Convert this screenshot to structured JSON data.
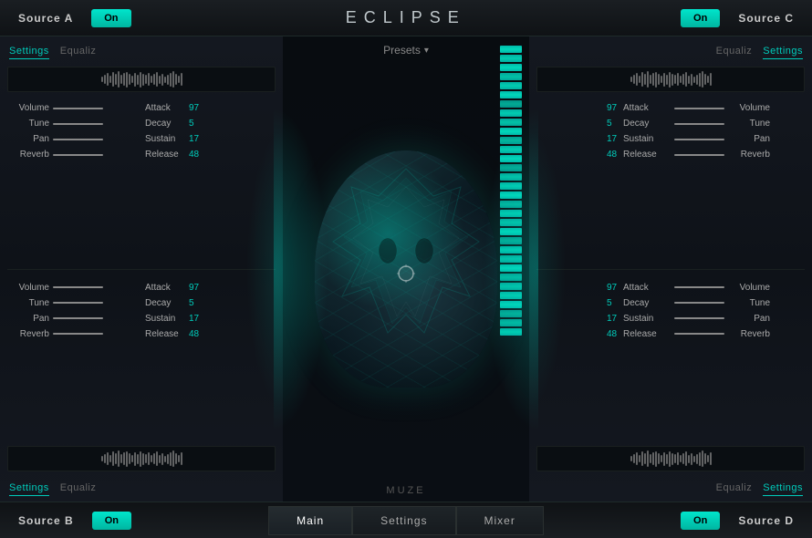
{
  "app": {
    "title": "ECLIPSE"
  },
  "topBar": {
    "sourceA": "Source  A",
    "sourceC": "Source  C",
    "onButtonA": "On",
    "onButtonC": "On"
  },
  "bottomBar": {
    "sourceB": "Source  B",
    "sourceD": "Source  D",
    "onButtonB": "On",
    "onButtonD": "On",
    "tabs": [
      "Main",
      "Settings",
      "Mixer"
    ],
    "activeTab": "Main"
  },
  "presets": {
    "label": "Presets",
    "arrow": "▾"
  },
  "muze": {
    "label": "MUZE"
  },
  "topLeftPanel": {
    "tabs": [
      "Settings",
      "Equaliz"
    ],
    "activeTab": "Settings",
    "controls": {
      "volume": {
        "label": "Volume",
        "value": ""
      },
      "tune": {
        "label": "Tune",
        "value": ""
      },
      "pan": {
        "label": "Pan",
        "value": ""
      },
      "reverb": {
        "label": "Reverb",
        "value": ""
      }
    },
    "envelope": {
      "attack": {
        "label": "Attack",
        "value": "97"
      },
      "decay": {
        "label": "Decay",
        "value": "5"
      },
      "sustain": {
        "label": "Sustain",
        "value": "17"
      },
      "release": {
        "label": "Release",
        "value": "48"
      }
    }
  },
  "bottomLeftPanel": {
    "tabs": [
      "Settings",
      "Equaliz"
    ],
    "activeTab": "Settings",
    "controls": {
      "volume": {
        "label": "Volume",
        "value": ""
      },
      "tune": {
        "label": "Tune",
        "value": ""
      },
      "pan": {
        "label": "Pan",
        "value": ""
      },
      "reverb": {
        "label": "Reverb",
        "value": ""
      }
    },
    "envelope": {
      "attack": {
        "label": "Attack",
        "value": "97"
      },
      "decay": {
        "label": "Decay",
        "value": "5"
      },
      "sustain": {
        "label": "Sustain",
        "value": "17"
      },
      "release": {
        "label": "Release",
        "value": "48"
      }
    }
  },
  "topRightPanel": {
    "tabs": [
      "Equaliz",
      "Settings"
    ],
    "activeTab": "Settings",
    "controls": {
      "volume": {
        "label": "Volume",
        "value": ""
      },
      "tune": {
        "label": "Tune",
        "value": ""
      },
      "pan": {
        "label": "Pan",
        "value": ""
      },
      "reverb": {
        "label": "Reverb",
        "value": ""
      }
    },
    "envelope": {
      "attack": {
        "label": "Attack",
        "value": "97"
      },
      "decay": {
        "label": "Decay",
        "value": "5"
      },
      "sustain": {
        "label": "Sustain",
        "value": "17"
      },
      "release": {
        "label": "Release",
        "value": "48"
      }
    }
  },
  "bottomRightPanel": {
    "tabs": [
      "Equaliz",
      "Settings"
    ],
    "activeTab": "Settings",
    "controls": {
      "volume": {
        "label": "Volume",
        "value": ""
      },
      "tune": {
        "label": "Tune",
        "value": ""
      },
      "pan": {
        "label": "Pan",
        "value": ""
      },
      "reverb": {
        "label": "Reverb",
        "value": ""
      }
    },
    "envelope": {
      "attack": {
        "label": "Attack",
        "value": "97"
      },
      "decay": {
        "label": "Decay",
        "value": "5"
      },
      "sustain": {
        "label": "Sustain",
        "value": "17"
      },
      "release": {
        "label": "Release",
        "value": "48"
      }
    }
  }
}
